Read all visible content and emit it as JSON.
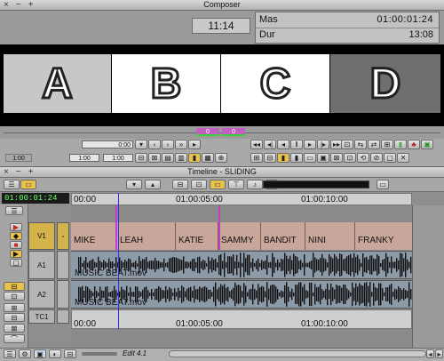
{
  "composer": {
    "title": "Composer",
    "window_controls": [
      "×",
      "−",
      "+"
    ],
    "timecode_small": "11:14",
    "mas_label": "Mas",
    "mas_value": "01:00:01:24",
    "dur_label": "Dur",
    "dur_value": "13:08",
    "frames": [
      {
        "letter": "A",
        "bg": "#c7c7c7"
      },
      {
        "letter": "B",
        "bg": "#ffffff"
      },
      {
        "letter": "C",
        "bg": "#ffffff"
      },
      {
        "letter": "D",
        "bg": "#6f6f6f"
      }
    ],
    "trim_left": "0",
    "trim_right": "0",
    "pos_value": "0:00",
    "field_a": "1:00",
    "field_b": "1:00",
    "field_c": "1:00"
  },
  "timeline": {
    "title": "Timeline - SLIDING",
    "window_controls": [
      "×",
      "−",
      "+"
    ],
    "timecode": "01:00:01:24",
    "ruler_top": [
      "00:00",
      "01:00:05:00",
      "01:00:10:00"
    ],
    "ruler_bottom": [
      "00:00",
      "01:00:05:00",
      "01:00:10:00"
    ],
    "tracks": [
      {
        "name": "V1",
        "type": "video"
      },
      {
        "name": "A1",
        "type": "audio"
      },
      {
        "name": "A2",
        "type": "audio"
      },
      {
        "name": "TC1",
        "type": "timecode"
      }
    ],
    "clips": [
      "MIKE",
      "LEAH",
      "KATIE",
      "SAMMY",
      "BANDIT",
      "NINI",
      "FRANKY"
    ],
    "audio_clip_name": "MUSIC BEAT.mov",
    "status_edit": "Edit 4.1"
  },
  "colors": {
    "video_clip": "#c8a79a",
    "audio_clip": "#8d9aa8",
    "playhead": "#2a2aff",
    "edit_marker": "#c040c0",
    "timecode_green": "#6cff6c"
  }
}
